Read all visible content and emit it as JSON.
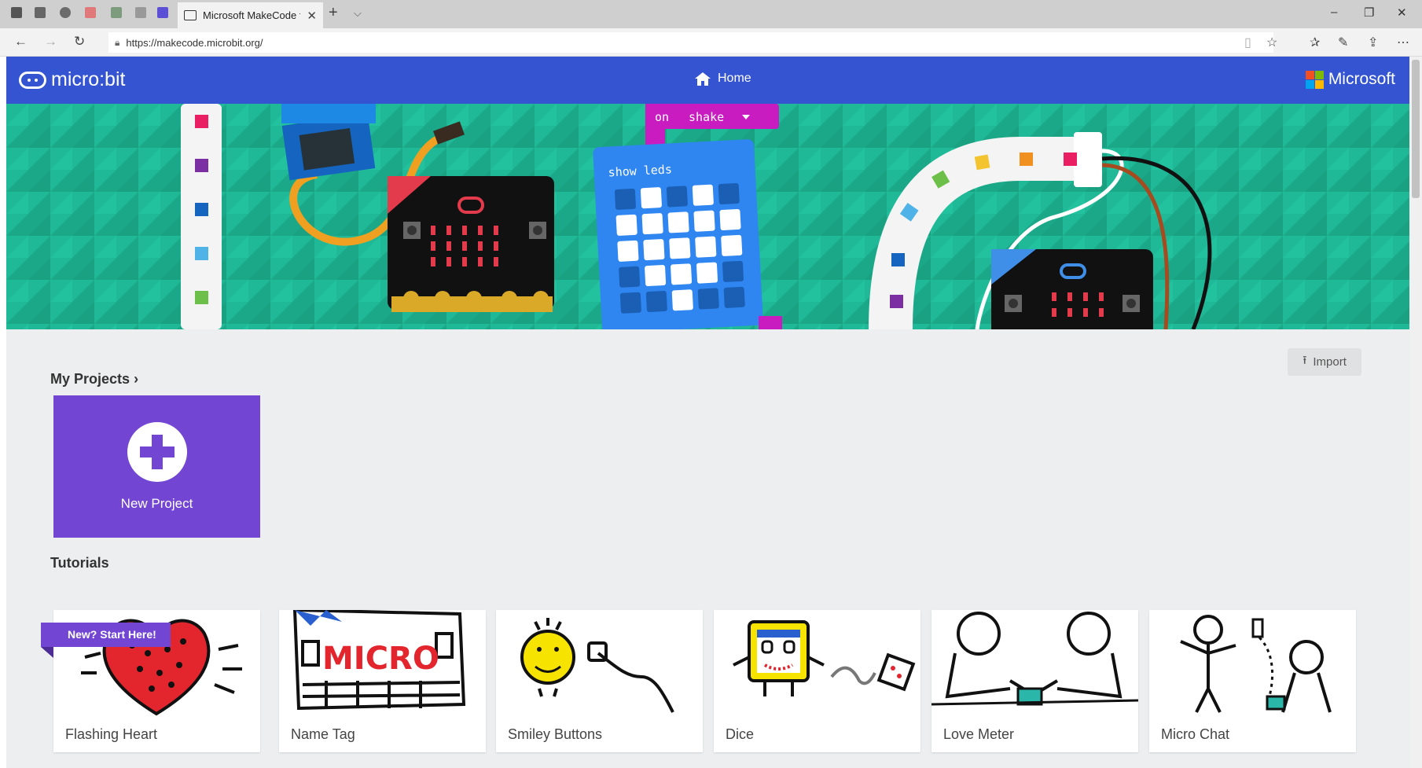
{
  "browser": {
    "tab_title": "Microsoft MakeCode fo",
    "url": "https://makecode.microbit.org/"
  },
  "header": {
    "brand": "micro:bit",
    "home_label": "Home",
    "microsoft_label": "Microsoft"
  },
  "hero": {
    "block_on": "on",
    "block_shake": "shake",
    "block_show_leds": "show leds"
  },
  "my_projects": {
    "title": "My Projects",
    "import_label": "Import",
    "new_project_label": "New Project"
  },
  "tutorials": {
    "title": "Tutorials",
    "ribbon": "New? Start Here!",
    "items": [
      {
        "label": "Flashing Heart",
        "art_text": ""
      },
      {
        "label": "Name Tag",
        "art_text": "MICRO"
      },
      {
        "label": "Smiley Buttons",
        "art_text": ""
      },
      {
        "label": "Dice",
        "art_text": ""
      },
      {
        "label": "Love Meter",
        "art_text": ""
      },
      {
        "label": "Micro Chat",
        "art_text": ""
      }
    ]
  },
  "colors": {
    "header_blue": "#3454d1",
    "hero_green": "#1fb997",
    "new_project_purple": "#7246d3",
    "page_bg": "#eceef0",
    "block_magenta": "#c81bc0",
    "block_blue": "#2f86f0"
  }
}
